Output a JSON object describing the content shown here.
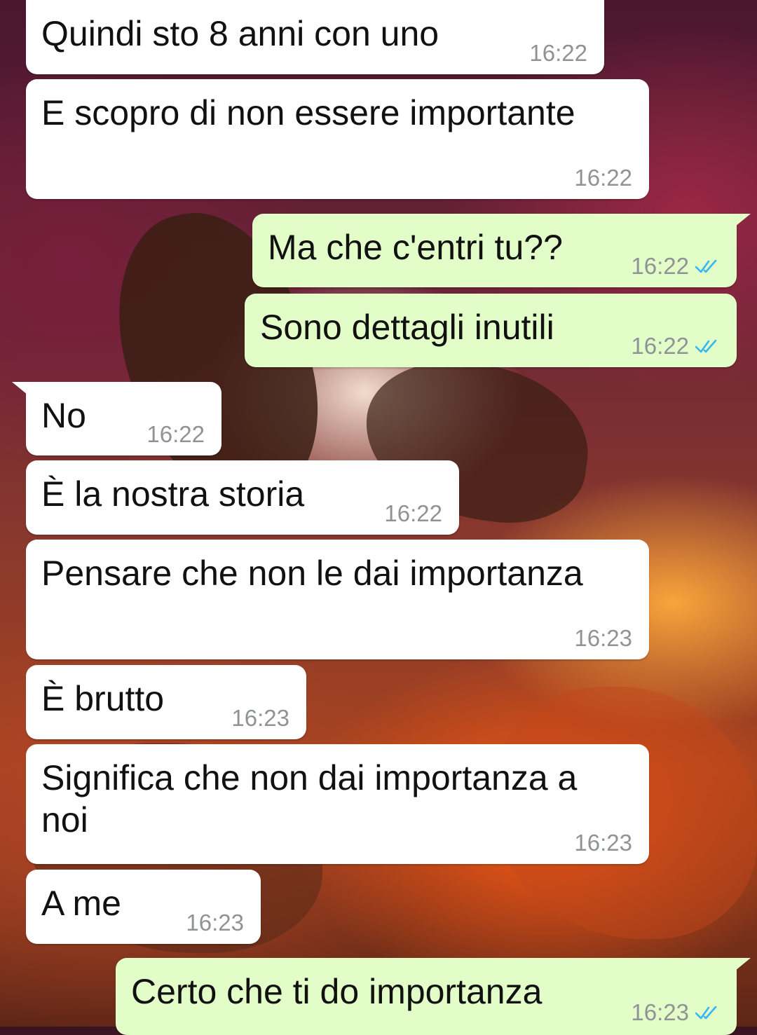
{
  "chat": {
    "messages": [
      {
        "text": "Quindi sto 8 anni con uno",
        "time": "16:22",
        "direction": "incoming"
      },
      {
        "text": "E scopro di non essere importante",
        "time": "16:22",
        "direction": "incoming"
      },
      {
        "text": "Ma che c'entri tu??",
        "time": "16:22",
        "direction": "outgoing",
        "status": "read"
      },
      {
        "text": "Sono dettagli inutili",
        "time": "16:22",
        "direction": "outgoing",
        "status": "read"
      },
      {
        "text": "No",
        "time": "16:22",
        "direction": "incoming"
      },
      {
        "text": "È la nostra storia",
        "time": "16:22",
        "direction": "incoming"
      },
      {
        "text": "Pensare che non le dai importanza",
        "time": "16:23",
        "direction": "incoming"
      },
      {
        "text": "È brutto",
        "time": "16:23",
        "direction": "incoming"
      },
      {
        "text": "Significa che non dai importanza a noi",
        "time": "16:23",
        "direction": "incoming"
      },
      {
        "text": "A me",
        "time": "16:23",
        "direction": "incoming"
      },
      {
        "text": "Certo che ti do importanza",
        "time": "16:23",
        "direction": "outgoing",
        "status": "read"
      }
    ]
  },
  "colors": {
    "incoming_bubble": "#ffffff",
    "outgoing_bubble": "#e2fdc8",
    "read_ticks": "#34b7f1",
    "timestamp": "#8f9396"
  },
  "icons": {
    "read_receipt": "double-check-icon"
  }
}
